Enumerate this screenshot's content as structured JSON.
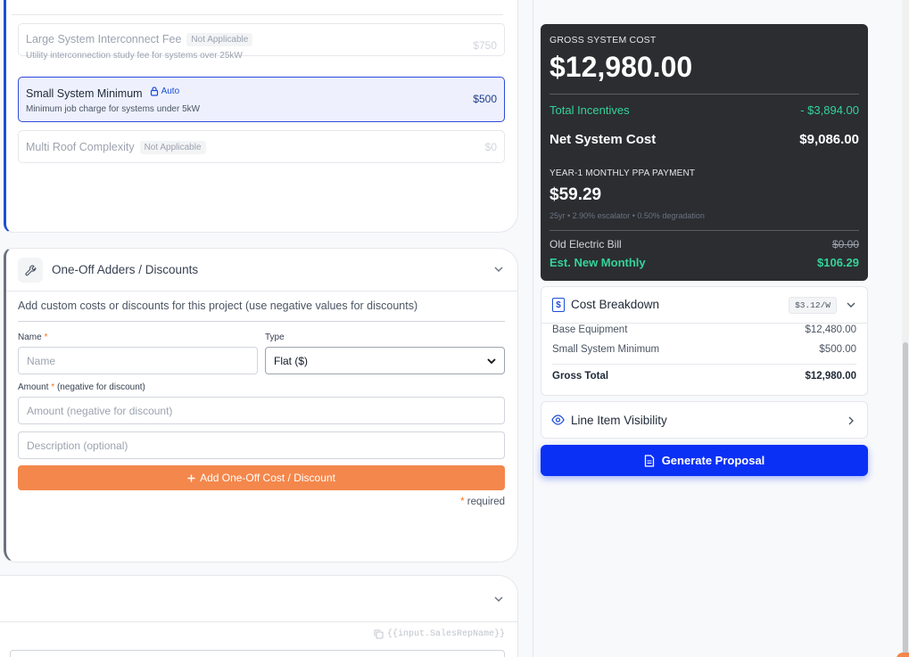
{
  "adders": [
    {
      "title": "Large System Interconnect Fee",
      "badge": "Not Applicable",
      "desc": "Utility interconnection study fee for systems over 25kW",
      "price": "$750"
    },
    {
      "title": "Small System Minimum",
      "badge": "Auto",
      "desc": "Minimum job charge for systems under 5kW",
      "price": "$500"
    },
    {
      "title": "Multi Roof Complexity",
      "badge": "Not Applicable",
      "desc": "",
      "price": "$0"
    }
  ],
  "one_off": {
    "title": "One-Off Adders / Discounts",
    "helper": "Add custom costs or discounts for this project (use negative values for discounts)",
    "name_label": "Name",
    "name_placeholder": "Name",
    "type_label": "Type",
    "type_value": "Flat ($)",
    "amount_label": "Amount",
    "amount_hint": "(negative for discount)",
    "amount_placeholder": "Amount (negative for discount)",
    "desc_placeholder": "Description (optional)",
    "add_button": "Add One-Off Cost / Discount",
    "required_note": "required",
    "required_mark": "*"
  },
  "bottom_card": {
    "tag_ref": "{{input.SalesRepName}}"
  },
  "summary": {
    "gross_label": "GROSS SYSTEM COST",
    "gross_value": "$12,980.00",
    "incentives_label": "Total Incentives",
    "incentives_value": "- $3,894.00",
    "net_label": "Net System Cost",
    "net_value": "$9,086.00",
    "ppa_label": "YEAR-1 MONTHLY PPA PAYMENT",
    "ppa_value": "$59.29",
    "ppa_sub": "25yr • 2.90% escalator • 0.50% degradation",
    "old_bill_label": "Old Electric Bill",
    "old_bill_value": "$0.00",
    "new_monthly_label": "Est. New Monthly",
    "new_monthly_value": "$106.29"
  },
  "cost_breakdown": {
    "title": "Cost Breakdown",
    "per_watt": "$3.12/W",
    "rows": [
      {
        "label": "Base Equipment",
        "value": "$12,480.00"
      },
      {
        "label": "Small System Minimum",
        "value": "$500.00"
      }
    ],
    "total_label": "Gross Total",
    "total_value": "$12,980.00"
  },
  "visibility": {
    "title": "Line Item Visibility"
  },
  "generate_button": "Generate Proposal",
  "colors": {
    "primary": "#0a30f5",
    "accent_orange": "#f4874b",
    "green": "#34d399",
    "dark_card": "#2b2d31"
  }
}
